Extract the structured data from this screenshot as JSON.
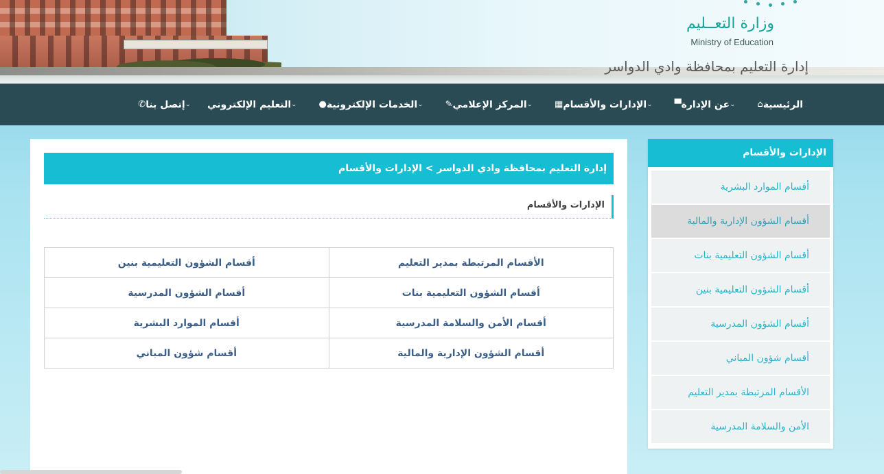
{
  "header": {
    "logo_ar": "وزارة التعــليم",
    "logo_en": "Ministry of Education",
    "site_title": "إدارة التعليم بمحافظة وادي الدواسر",
    "logo_icon": "ministry-logo-icon"
  },
  "nav": {
    "items": [
      {
        "label": "الرئيسية",
        "icon": "⌂",
        "has_dropdown": false
      },
      {
        "label": "عن الإدارة",
        "icon": "▀",
        "has_dropdown": true
      },
      {
        "label": "الإدارات والأقسام",
        "icon": "▦",
        "has_dropdown": true
      },
      {
        "label": "المركز الإعلامي",
        "icon": "✎",
        "has_dropdown": true
      },
      {
        "label": "الخدمات الإلكترونية",
        "icon": "●",
        "has_dropdown": true
      },
      {
        "label": "التعليم الإلكتروني",
        "icon": "",
        "has_dropdown": true
      },
      {
        "label": "إتصل بنا",
        "icon": "✆",
        "has_dropdown": true
      }
    ],
    "chevron": "⌄"
  },
  "main": {
    "breadcrumb": "إدارة التعليم بمحافظة وادي الدواسر > الإدارات والأقسام",
    "section_title": "الإدارات والأقسام",
    "table": [
      [
        "الأقسام المرتبطة بمدير التعليم",
        "أقسام الشؤون التعليمية بنين"
      ],
      [
        "أقسام الشؤون التعليمية بنات",
        "أقسام الشؤون المدرسية"
      ],
      [
        "أقسام الأمن والسلامة المدرسية",
        "أقسام الموارد البشرية"
      ],
      [
        "أقسام الشؤون الإدارية والمالية",
        "أقسام شؤون المباني"
      ]
    ]
  },
  "sidebar": {
    "heading": "الإدارات والأقسام",
    "items": [
      {
        "label": "أقسام الموارد البشرية",
        "active": false
      },
      {
        "label": "أقسام الشؤون الإدارية والمالية",
        "active": true
      },
      {
        "label": "أقسام الشؤون التعليمية بنات",
        "active": false
      },
      {
        "label": "أقسام الشؤون التعليمية بنين",
        "active": false
      },
      {
        "label": "أقسام الشؤون المدرسية",
        "active": false
      },
      {
        "label": "أقسام شؤون المباني",
        "active": false
      },
      {
        "label": "الأقسام المرتبطة بمدير التعليم",
        "active": false
      },
      {
        "label": "الأمن والسلامة المدرسية",
        "active": false
      }
    ]
  },
  "colors": {
    "nav_bg": "#2a4b53",
    "accent": "#17bdd3",
    "link": "#3c5f88",
    "sidebar_link": "#2bb3c7"
  }
}
